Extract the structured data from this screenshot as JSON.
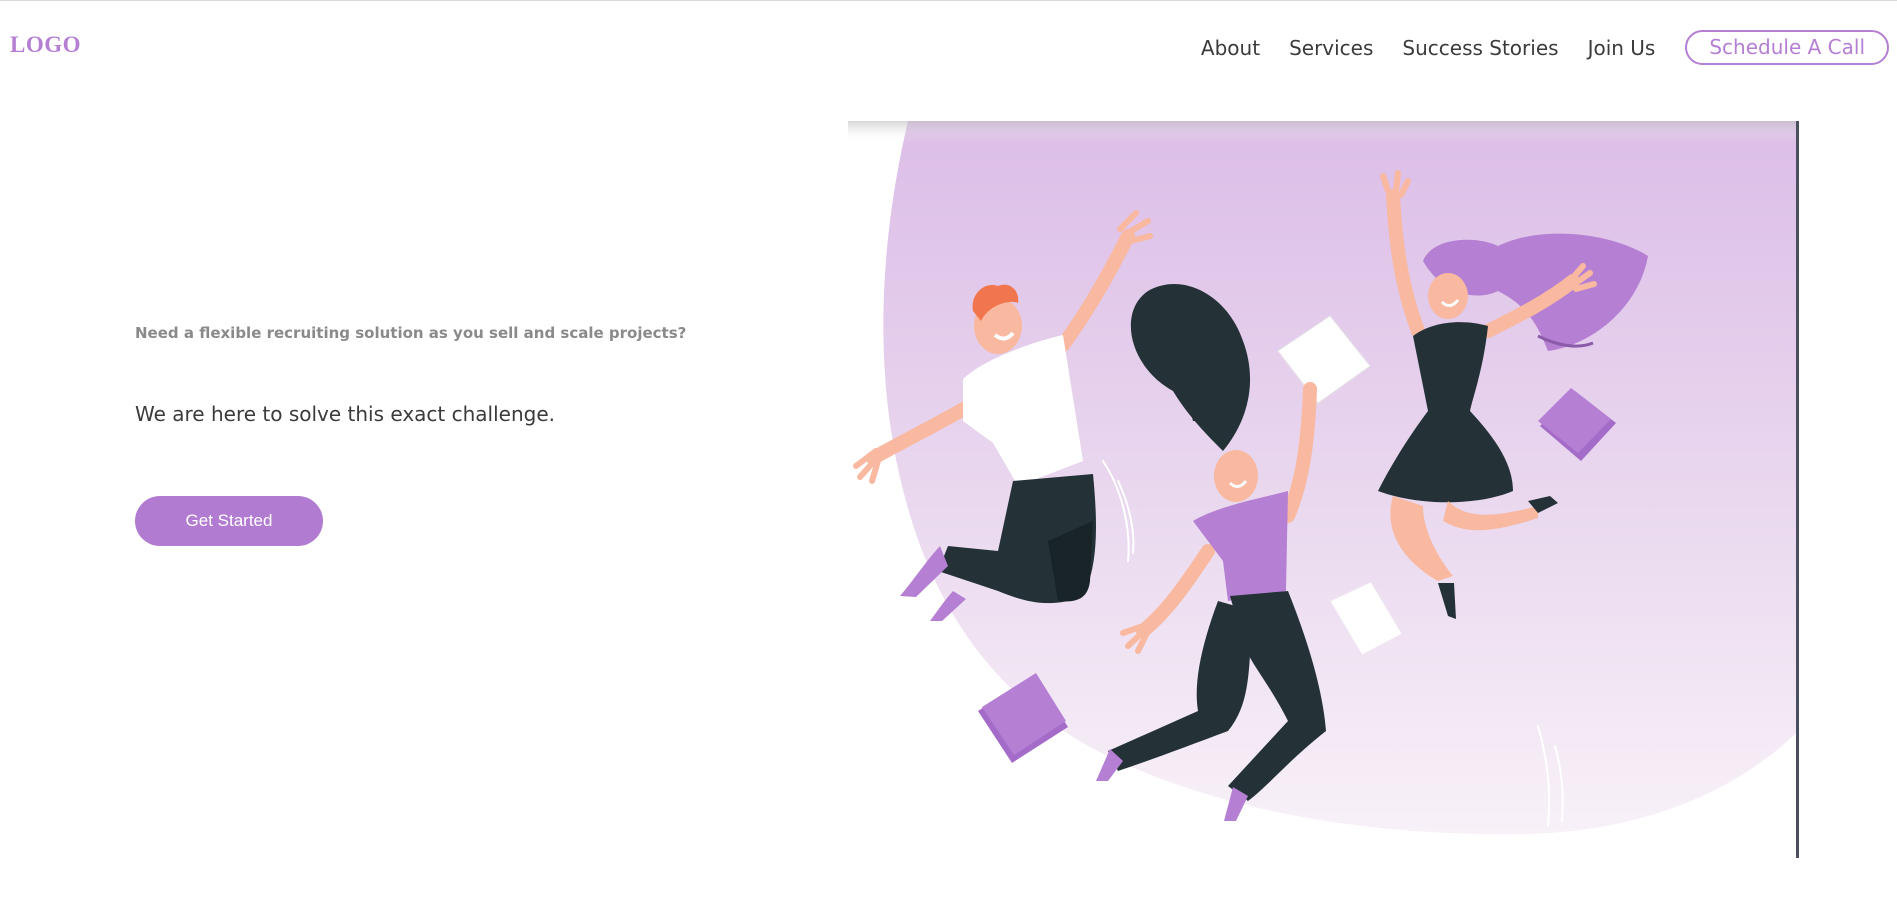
{
  "header": {
    "logo": "LOGO",
    "nav": {
      "about": "About",
      "services": "Services",
      "success_stories": "Success Stories",
      "join_us": "Join Us",
      "schedule_call": "Schedule A Call"
    }
  },
  "hero": {
    "kicker": "Need a flexible recruiting solution as you sell and scale projects?",
    "headline": "We are here to solve this exact challenge.",
    "cta_label": "Get Started",
    "illustration": "people-jumping-illustration"
  },
  "colors": {
    "accent": "#b57fd3",
    "button": "#b27bd2",
    "dark": "#243238"
  }
}
